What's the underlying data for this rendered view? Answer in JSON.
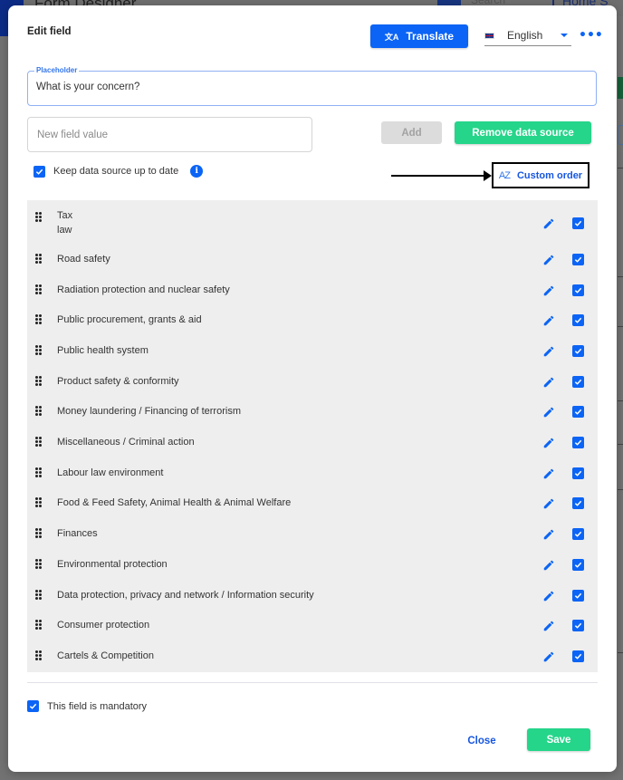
{
  "background": {
    "app_title": "Form Designer",
    "search_placeholder": "Search",
    "nav_home": "Home",
    "nav_partial": "S"
  },
  "modal": {
    "title": "Edit field",
    "translate_label": "Translate",
    "translate_icon": "translate-icon",
    "language": {
      "selected": "English",
      "flag": "uk-flag-icon"
    },
    "more_icon": "more-horizontal-icon",
    "placeholder_field": {
      "legend": "Placeholder",
      "value": "What is your concern?"
    },
    "new_value_field": {
      "value": "",
      "placeholder": "New field value"
    },
    "add_label": "Add",
    "remove_data_source_label": "Remove data source",
    "keep_up_to_date": {
      "label": "Keep data source up to date",
      "checked": true
    },
    "custom_order": {
      "icon": "sort-az-icon",
      "icon_text": "AZ",
      "label": "Custom order"
    },
    "items": [
      {
        "label": "Tax\nlaw",
        "checked": true
      },
      {
        "label": "Road safety",
        "checked": true
      },
      {
        "label": "Radiation protection and nuclear safety",
        "checked": true
      },
      {
        "label": "Public procurement, grants & aid",
        "checked": true
      },
      {
        "label": "Public health system",
        "checked": true
      },
      {
        "label": "Product safety & conformity",
        "checked": true
      },
      {
        "label": "Money laundering / Financing of terrorism",
        "checked": true
      },
      {
        "label": "Miscellaneous / Criminal action",
        "checked": true
      },
      {
        "label": "Labour law environment",
        "checked": true
      },
      {
        "label": "Food & Feed Safety, Animal Health & Animal Welfare",
        "checked": true
      },
      {
        "label": "Finances",
        "checked": true
      },
      {
        "label": "Environmental protection",
        "checked": true
      },
      {
        "label": "Data protection, privacy and network / Information security",
        "checked": true
      },
      {
        "label": "Consumer protection",
        "checked": true
      },
      {
        "label": "Cartels & Competition",
        "checked": true
      }
    ],
    "mandatory": {
      "label": "This field is mandatory",
      "checked": true
    },
    "close_label": "Close",
    "save_label": "Save"
  },
  "colors": {
    "primary": "#0b64f5",
    "success": "#25d58a",
    "list_bg": "#eeeeee",
    "disabled": "#dcdcdc"
  }
}
